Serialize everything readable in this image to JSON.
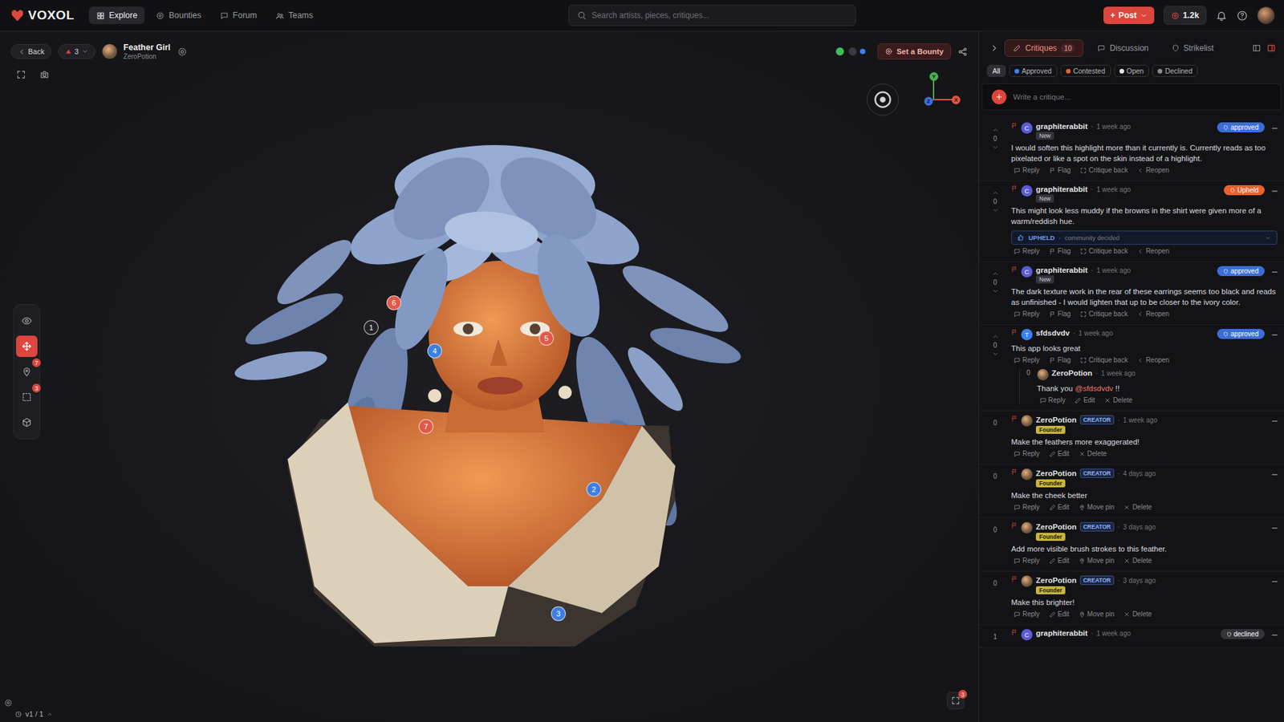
{
  "separator": "·",
  "app": {
    "logo": "VOXOL",
    "nav": [
      {
        "label": "Explore",
        "selected": true
      },
      {
        "label": "Bounties",
        "selected": false
      },
      {
        "label": "Forum",
        "selected": false
      },
      {
        "label": "Teams",
        "selected": false
      }
    ],
    "search": {
      "placeholder": "Search artists, pieces, critiques..."
    },
    "post": {
      "icon": "+",
      "label": "Post"
    },
    "points": "1.2k"
  },
  "piece": {
    "back": "Back",
    "votes": "3",
    "title": "Feather Girl",
    "author": "ZeroPotion",
    "bounty": "Set a Bounty",
    "presence": [
      {
        "color": "#3fbf5a"
      },
      {
        "color": "#3a3a42"
      },
      {
        "color": "#3b82f6"
      }
    ]
  },
  "viewport": {
    "tools": [
      {
        "kind": "view",
        "selected": false
      },
      {
        "kind": "move",
        "selected": true
      },
      {
        "kind": "pin",
        "selected": false,
        "badge": "7"
      },
      {
        "kind": "region",
        "selected": false,
        "badge": "3"
      },
      {
        "kind": "model",
        "selected": false
      }
    ],
    "pins": [
      {
        "label": "6",
        "color": "#e05a4a"
      },
      {
        "label": "1",
        "color": "#222228"
      },
      {
        "label": "4",
        "color": "#3d7fe0"
      },
      {
        "label": "5",
        "color": "#e05a4a"
      },
      {
        "label": "7",
        "color": "#e05a4a"
      },
      {
        "label": "2",
        "color": "#3d7fe0"
      },
      {
        "label": "3",
        "color": "#3d7fe0"
      }
    ],
    "axes": [
      {
        "label": "Y",
        "color": "#4caf50"
      },
      {
        "label": "X",
        "color": "#e0533f"
      },
      {
        "label": "Z",
        "color": "#3d6fe0"
      }
    ],
    "version": "v1 / 1",
    "fullscreen_badge": "3"
  },
  "panel": {
    "tabs": [
      {
        "label": "Critiques",
        "count": "10",
        "selected": true
      },
      {
        "label": "Discussion",
        "selected": false
      },
      {
        "label": "Strikelist",
        "selected": false
      }
    ],
    "filters": [
      {
        "label": "All",
        "selected": true
      },
      {
        "label": "Approved",
        "selected": false,
        "color": "#3b82f6"
      },
      {
        "label": "Contested",
        "selected": false,
        "color": "#e8622c"
      },
      {
        "label": "Open",
        "selected": false,
        "color": "#e6e6e6"
      },
      {
        "label": "Declined",
        "selected": false,
        "color": "#8a8a90"
      }
    ],
    "critique_placeholder": "Write a critique...",
    "critiques": [
      {
        "author": "graphiterabbit",
        "avatar": "C",
        "avatar_color": "#5b5bd6",
        "time": "1 week ago",
        "tag": "New",
        "status": {
          "label": "approved",
          "color": "#3b6fd8"
        },
        "votes": "0",
        "vote_arrows": true,
        "text": "I would soften this highlight more than it currently is. Currently reads as too pixelated or like a spot on the skin instead of a highlight.",
        "actions": [
          {
            "label": "Reply",
            "kind": "reply"
          },
          {
            "label": "Flag",
            "kind": "flag"
          },
          {
            "label": "Critique back",
            "kind": "bracket"
          },
          {
            "label": "Reopen",
            "kind": "reopen"
          }
        ],
        "replies": []
      },
      {
        "author": "graphiterabbit",
        "avatar": "C",
        "avatar_color": "#5b5bd6",
        "time": "1 week ago",
        "tag": "New",
        "status": {
          "label": "Upheld",
          "color": "#e8622c"
        },
        "votes": "0",
        "vote_arrows": true,
        "text": "This might look less muddy if the browns in the shirt were given more of a warm/reddish hue.",
        "verdict": {
          "label": "UPHELD",
          "note": "community decided"
        },
        "actions": [
          {
            "label": "Reply",
            "kind": "reply"
          },
          {
            "label": "Flag",
            "kind": "flag"
          },
          {
            "label": "Critique back",
            "kind": "bracket"
          },
          {
            "label": "Reopen",
            "kind": "reopen"
          }
        ],
        "replies": []
      },
      {
        "author": "graphiterabbit",
        "avatar": "C",
        "avatar_color": "#5b5bd6",
        "time": "1 week ago",
        "tag": "New",
        "status": {
          "label": "approved",
          "color": "#3b6fd8"
        },
        "votes": "0",
        "vote_arrows": true,
        "text": "The dark texture work in the rear of these earrings seems too black and reads as unfinished - I would lighten that up to be closer to the ivory color.",
        "actions": [
          {
            "label": "Reply",
            "kind": "reply"
          },
          {
            "label": "Flag",
            "kind": "flag"
          },
          {
            "label": "Critique back",
            "kind": "bracket"
          },
          {
            "label": "Reopen",
            "kind": "reopen"
          }
        ],
        "replies": []
      },
      {
        "author": "sfdsdvdv",
        "avatar": "T",
        "avatar_color": "#3b82f6",
        "time": "1 week ago",
        "status": {
          "label": "approved",
          "color": "#3b6fd8"
        },
        "votes": "0",
        "vote_arrows": true,
        "text": "This app looks great",
        "actions": [
          {
            "label": "Reply",
            "kind": "reply"
          },
          {
            "label": "Flag",
            "kind": "flag"
          },
          {
            "label": "Critique back",
            "kind": "bracket"
          },
          {
            "label": "Reopen",
            "kind": "reopen"
          }
        ],
        "replies": [
          {
            "author": "ZeroPotion",
            "time": "1 week ago",
            "votes": "0",
            "text": [
              {
                "text": "Thank you ",
                "mention": false
              },
              {
                "text": "@sfdsdvdv",
                "mention": true
              },
              {
                "text": " !!",
                "mention": false
              }
            ],
            "actions": [
              {
                "label": "Reply",
                "kind": "reply"
              },
              {
                "label": "Edit",
                "kind": "edit"
              },
              {
                "label": "Delete",
                "kind": "x"
              }
            ]
          }
        ]
      },
      {
        "author": "ZeroPotion",
        "role": "CREATOR",
        "badge": "Founder",
        "time": "1 week ago",
        "votes": "0",
        "vote_arrows": false,
        "text": "Make the feathers more exaggerated!",
        "actions": [
          {
            "label": "Reply",
            "kind": "reply"
          },
          {
            "label": "Edit",
            "kind": "edit"
          },
          {
            "label": "Delete",
            "kind": "x"
          }
        ],
        "replies": []
      },
      {
        "author": "ZeroPotion",
        "role": "CREATOR",
        "badge": "Founder",
        "time": "4 days ago",
        "votes": "0",
        "vote_arrows": false,
        "text": "Make the cheek better",
        "actions": [
          {
            "label": "Reply",
            "kind": "reply"
          },
          {
            "label": "Edit",
            "kind": "edit"
          },
          {
            "label": "Move pin",
            "kind": "pin"
          },
          {
            "label": "Delete",
            "kind": "x"
          }
        ],
        "replies": []
      },
      {
        "author": "ZeroPotion",
        "role": "CREATOR",
        "badge": "Founder",
        "time": "3 days ago",
        "votes": "0",
        "vote_arrows": false,
        "text": "Add more visible brush strokes to this feather.",
        "actions": [
          {
            "label": "Reply",
            "kind": "reply"
          },
          {
            "label": "Edit",
            "kind": "edit"
          },
          {
            "label": "Move pin",
            "kind": "pin"
          },
          {
            "label": "Delete",
            "kind": "x"
          }
        ],
        "replies": []
      },
      {
        "author": "ZeroPotion",
        "role": "CREATOR",
        "badge": "Founder",
        "time": "3 days ago",
        "votes": "0",
        "vote_arrows": false,
        "text": "Make this brighter!",
        "actions": [
          {
            "label": "Reply",
            "kind": "reply"
          },
          {
            "label": "Edit",
            "kind": "edit"
          },
          {
            "label": "Move pin",
            "kind": "pin"
          },
          {
            "label": "Delete",
            "kind": "x"
          }
        ],
        "replies": []
      },
      {
        "author": "graphiterabbit",
        "avatar": "C",
        "avatar_color": "#5b5bd6",
        "time": "1 week ago",
        "status": {
          "label": "declined",
          "color": "#34343a"
        },
        "votes": "1",
        "vote_arrows": false,
        "actions": [],
        "replies": []
      }
    ]
  }
}
